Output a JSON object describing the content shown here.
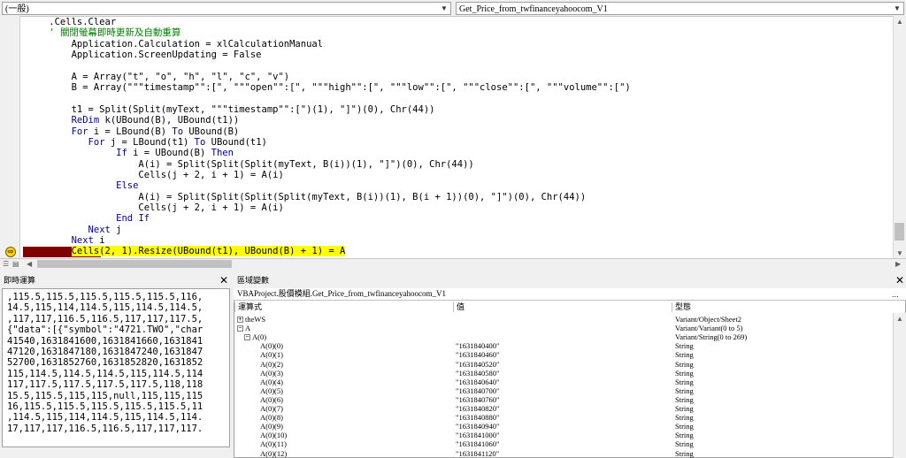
{
  "object_combo": "(一般)",
  "proc_combo": "Get_Price_from_twfinanceyahoocom_V1",
  "code_lines": [
    [
      {
        "t": "    .Cells.Clear"
      }
    ],
    [
      {
        "t": "    ' ",
        "c": "cm"
      },
      {
        "t": "關閉螢幕即時更新及自動重算",
        "c": "cm"
      }
    ],
    [
      {
        "t": "        Application.Calculation = xlCalculationManual"
      }
    ],
    [
      {
        "t": "        Application.ScreenUpdating = False"
      }
    ],
    [
      {
        "t": ""
      }
    ],
    [
      {
        "t": "        A = Array(\"t\", \"o\", \"h\", \"l\", \"c\", \"v\")"
      }
    ],
    [
      {
        "t": "        B = Array(\"\"\"timestamp\"\":[\", \"\"\"open\"\":[\", \"\"\"high\"\":[\", \"\"\"low\"\":[\", \"\"\"close\"\":[\", \"\"\"volume\"\":[\")"
      }
    ],
    [
      {
        "t": ""
      }
    ],
    [
      {
        "t": "        t1 = Split(Split(myText, \"\"\"timestamp\"\":[\")(1), \"]\")(0), Chr(44))"
      }
    ],
    [
      {
        "t": "        "
      },
      {
        "t": "ReDim",
        "c": "kw"
      },
      {
        "t": " k(UBound(B), UBound(t1))"
      }
    ],
    [
      {
        "t": "        "
      },
      {
        "t": "For",
        "c": "kw"
      },
      {
        "t": " i = LBound(B) "
      },
      {
        "t": "To",
        "c": "kw"
      },
      {
        "t": " UBound(B)"
      }
    ],
    [
      {
        "t": "           "
      },
      {
        "t": "For",
        "c": "kw"
      },
      {
        "t": " j = LBound(t1) "
      },
      {
        "t": "To",
        "c": "kw"
      },
      {
        "t": " UBound(t1)"
      }
    ],
    [
      {
        "t": "                "
      },
      {
        "t": "If",
        "c": "kw"
      },
      {
        "t": " i = UBound(B) "
      },
      {
        "t": "Then",
        "c": "kw"
      }
    ],
    [
      {
        "t": "                    A(i) = Split(Split(Split(myText, B(i))(1), \"]\")(0), Chr(44))"
      }
    ],
    [
      {
        "t": "                    Cells(j + 2, i + 1) = A(i)"
      }
    ],
    [
      {
        "t": "                "
      },
      {
        "t": "Else",
        "c": "kw"
      }
    ],
    [
      {
        "t": "                    A(i) = Split(Split(Split(Split(myText, B(i))(1), B(i + 1))(0), \"]\")(0), Chr(44))"
      }
    ],
    [
      {
        "t": "                    Cells(j + 2, i + 1) = A(i)"
      }
    ],
    [
      {
        "t": "                "
      },
      {
        "t": "End If",
        "c": "kw"
      }
    ],
    [
      {
        "t": "           "
      },
      {
        "t": "Next",
        "c": "kw"
      },
      {
        "t": " j"
      }
    ],
    [
      {
        "t": "        "
      },
      {
        "t": "Next",
        "c": "kw"
      },
      {
        "t": " i"
      }
    ],
    [
      {
        "t": "        "
      },
      {
        "t": "Cells(2, 1).Resize(UBound(t1), UBound(B) + 1) = A",
        "c": "hl"
      }
    ]
  ],
  "immediate": {
    "title": "即時運算",
    "lines": [
      ",115.5,115.5,115.5,115.5,115.5,116,",
      "14.5,115,114,114.5,115,114.5,114.5,",
      ",117,117,116.5,116.5,117,117,117.5,",
      "{\"data\":[{\"symbol\":\"4721.TWO\",\"char",
      "41540,1631841600,1631841660,1631841",
      "47120,1631847180,1631847240,1631847",
      "52700,1631852760,1631852820,1631852",
      "115,114.5,114.5,114.5,115,114.5,114",
      "117,117.5,117.5,117.5,117.5,118,118",
      "15.5,115.5,115,115,null,115,115,115",
      "16,115.5,115.5,115.5,115.5,115.5,11",
      ",114.5,115,114,114.5,115,114.5,114.",
      "17,117,117,116.5,116.5,117,117,117."
    ]
  },
  "locals": {
    "title": "區域變數",
    "context": "VBAProject.股價模組.Get_Price_from_twfinanceyahoocom_V1",
    "headers": [
      "運算式",
      "值",
      "型態"
    ],
    "rows": [
      {
        "expr": "theWS",
        "value": "",
        "type": "Variant/Object/Sheet2",
        "box": "+",
        "level": 0
      },
      {
        "expr": "A",
        "value": "",
        "type": "Variant/Variant(0 to 5)",
        "box": "−",
        "level": 0
      },
      {
        "expr": "A(0)",
        "value": "",
        "type": "Variant/String(0 to 269)",
        "box": "−",
        "level": 1
      },
      {
        "expr": "A(0)(0)",
        "value": "\"1631840400\"",
        "type": "String",
        "box": "",
        "level": 2
      },
      {
        "expr": "A(0)(1)",
        "value": "\"1631840460\"",
        "type": "String",
        "box": "",
        "level": 2
      },
      {
        "expr": "A(0)(2)",
        "value": "\"1631840520\"",
        "type": "String",
        "box": "",
        "level": 2
      },
      {
        "expr": "A(0)(3)",
        "value": "\"1631840580\"",
        "type": "String",
        "box": "",
        "level": 2
      },
      {
        "expr": "A(0)(4)",
        "value": "\"1631840640\"",
        "type": "String",
        "box": "",
        "level": 2
      },
      {
        "expr": "A(0)(5)",
        "value": "\"1631840700\"",
        "type": "String",
        "box": "",
        "level": 2
      },
      {
        "expr": "A(0)(6)",
        "value": "\"1631840760\"",
        "type": "String",
        "box": "",
        "level": 2
      },
      {
        "expr": "A(0)(7)",
        "value": "\"1631840820\"",
        "type": "String",
        "box": "",
        "level": 2
      },
      {
        "expr": "A(0)(8)",
        "value": "\"1631840880\"",
        "type": "String",
        "box": "",
        "level": 2
      },
      {
        "expr": "A(0)(9)",
        "value": "\"1631840940\"",
        "type": "String",
        "box": "",
        "level": 2
      },
      {
        "expr": "A(0)(10)",
        "value": "\"1631841000\"",
        "type": "String",
        "box": "",
        "level": 2
      },
      {
        "expr": "A(0)(11)",
        "value": "\"1631841060\"",
        "type": "String",
        "box": "",
        "level": 2
      },
      {
        "expr": "A(0)(12)",
        "value": "\"1631841120\"",
        "type": "String",
        "box": "",
        "level": 2
      }
    ]
  },
  "colors": {
    "keyword": "#00009c",
    "comment": "#008000",
    "highlight": "#ffff00",
    "breakpoint_band": "#800000"
  }
}
